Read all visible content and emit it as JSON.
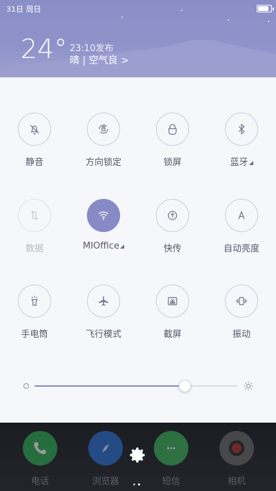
{
  "status_bar": {
    "date": "31日 周日",
    "battery_level_percent": 85
  },
  "weather": {
    "temperature": "24°",
    "update_time": "23:10发布",
    "condition": "晴 | 空气良 >"
  },
  "toggles": [
    {
      "label": "静音",
      "icon": "bell-off-icon",
      "state": "off"
    },
    {
      "label": "方向锁定",
      "icon": "rotation-lock-icon",
      "state": "off"
    },
    {
      "label": "锁屏",
      "icon": "lock-icon",
      "state": "off"
    },
    {
      "label": "蓝牙",
      "icon": "bluetooth-icon",
      "state": "off",
      "has_menu": true
    },
    {
      "label": "数据",
      "icon": "mobile-data-icon",
      "state": "disabled"
    },
    {
      "label": "MIOffice",
      "icon": "wifi-icon",
      "state": "on",
      "has_menu": true
    },
    {
      "label": "快传",
      "icon": "quick-share-icon",
      "state": "off"
    },
    {
      "label": "自动亮度",
      "icon": "auto-brightness-icon",
      "state": "off"
    },
    {
      "label": "手电筒",
      "icon": "flashlight-icon",
      "state": "off"
    },
    {
      "label": "飞行模式",
      "icon": "airplane-icon",
      "state": "off"
    },
    {
      "label": "截屏",
      "icon": "screenshot-icon",
      "state": "off"
    },
    {
      "label": "振动",
      "icon": "vibrate-icon",
      "state": "off"
    }
  ],
  "brightness": {
    "level_percent": 74
  },
  "dock": [
    {
      "label": "电话",
      "icon": "phone-app-icon",
      "color": "#2fae52"
    },
    {
      "label": "浏览器",
      "icon": "browser-app-icon",
      "color": "#2a6fd6"
    },
    {
      "label": "短信",
      "icon": "messages-app-icon",
      "color": "#3bb35a"
    },
    {
      "label": "相机",
      "icon": "camera-app-icon",
      "color": "#6a6a6a"
    }
  ],
  "colors": {
    "accent": "#878ac4",
    "header": "#8f93c9",
    "panel": "#f6f7fb"
  }
}
